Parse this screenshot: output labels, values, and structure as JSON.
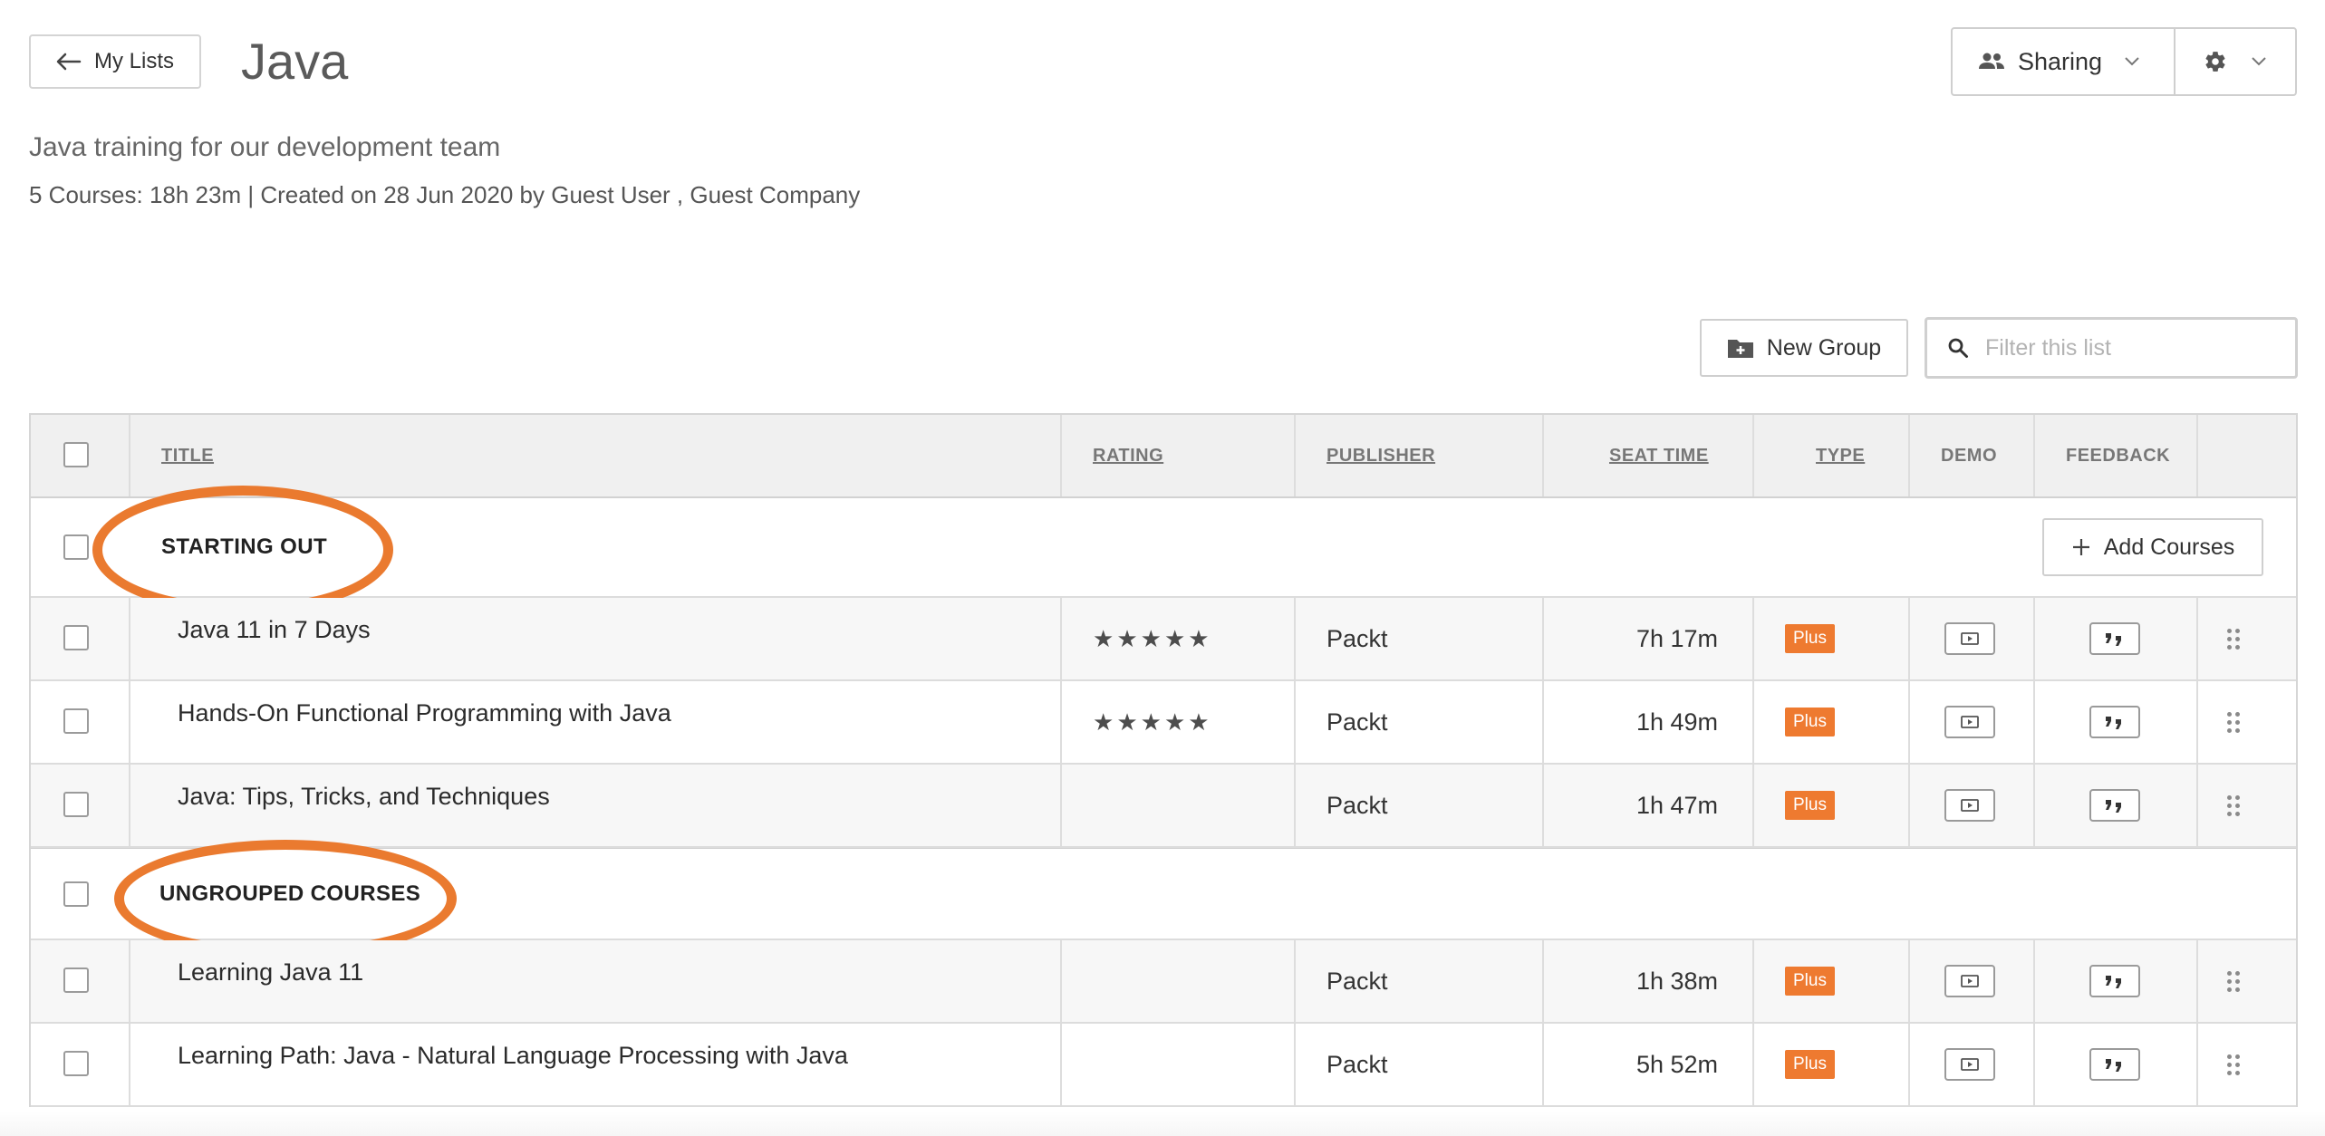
{
  "header": {
    "back_label": "My Lists",
    "title": "Java",
    "description": "Java training for our development team",
    "meta": "5 Courses: 18h 23m | Created on 28 Jun 2020 by Guest User , Guest Company",
    "sharing_label": "Sharing"
  },
  "toolbar": {
    "new_group_label": "New Group",
    "filter_placeholder": "Filter this list"
  },
  "table": {
    "columns": {
      "title": "TITLE",
      "rating": "RATING",
      "publisher": "PUBLISHER",
      "seat_time": "SEAT TIME",
      "type": "TYPE",
      "demo": "DEMO",
      "feedback": "FEEDBACK"
    },
    "groups": [
      {
        "name": "STARTING OUT",
        "add_label": "Add Courses",
        "courses": [
          {
            "title": "Java 11 in 7 Days",
            "rating": 5,
            "publisher": "Packt",
            "seat_time": "7h 17m",
            "type": "Plus"
          },
          {
            "title": "Hands-On Functional Programming with Java",
            "rating": 5,
            "publisher": "Packt",
            "seat_time": "1h 49m",
            "type": "Plus"
          },
          {
            "title": "Java: Tips, Tricks, and Techniques",
            "rating": 0,
            "publisher": "Packt",
            "seat_time": "1h 47m",
            "type": "Plus"
          }
        ]
      },
      {
        "name": "UNGROUPED COURSES",
        "courses": [
          {
            "title": "Learning Java 11",
            "rating": 0,
            "publisher": "Packt",
            "seat_time": "1h 38m",
            "type": "Plus"
          },
          {
            "title": "Learning Path: Java - Natural Language Processing with Java",
            "rating": 0,
            "publisher": "Packt",
            "seat_time": "5h 52m",
            "type": "Plus"
          }
        ]
      }
    ]
  },
  "colors": {
    "accent": "#ea7a2f",
    "plus_badge": "#ee7a30",
    "header_bg": "#f0f0f0"
  }
}
